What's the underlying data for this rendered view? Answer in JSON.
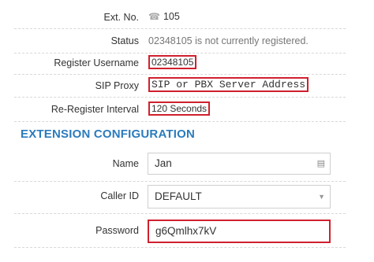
{
  "ext": {
    "label": "Ext. No.",
    "value": "105",
    "icon": "phone-icon"
  },
  "status": {
    "label": "Status",
    "value": "02348105 is not currently registered."
  },
  "register_username": {
    "label": "Register Username",
    "value": "02348105"
  },
  "sip_proxy": {
    "label": "SIP Proxy",
    "value": "SIP or PBX Server Address"
  },
  "reregister": {
    "label": "Re-Register Interval",
    "value": "120 Seconds"
  },
  "section_title": "EXTENSION CONFIGURATION",
  "name_field": {
    "label": "Name",
    "value": "Jan",
    "icon": "contact-card-icon"
  },
  "caller_id": {
    "label": "Caller ID",
    "value": "DEFAULT",
    "icon": "dropdown-caret-icon"
  },
  "password": {
    "label": "Password",
    "value": "g6Qmlhx7kV"
  },
  "colors": {
    "accent": "#2b7bbd",
    "highlight_border": "#d0202e"
  }
}
